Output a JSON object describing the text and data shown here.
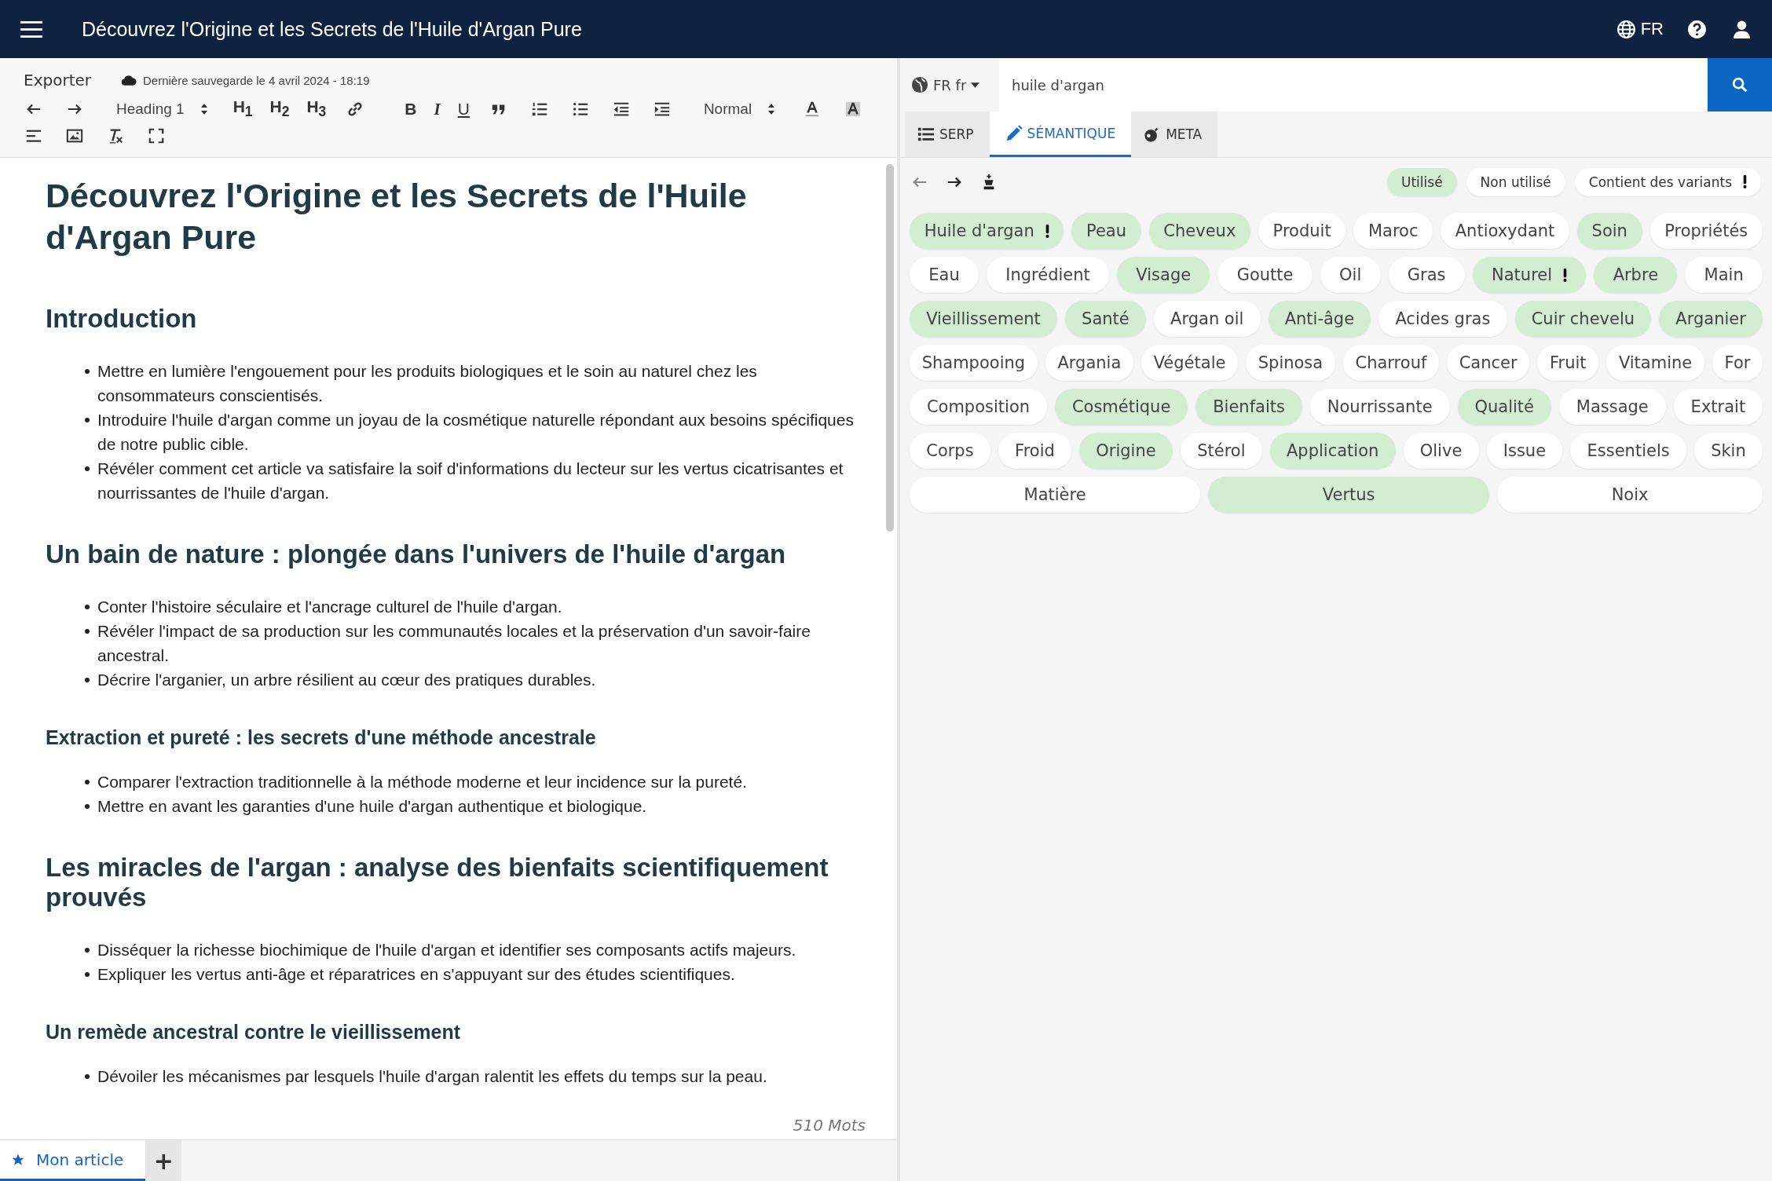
{
  "header": {
    "title": "Découvrez l'Origine et les Secrets de l'Huile d'Argan Pure",
    "lang": "FR"
  },
  "editor": {
    "export": "Exporter",
    "saved": "Dernière sauvegarde le 4 avril 2024 - 18:19",
    "toolbar": [
      [
        {
          "kind": "undo"
        },
        {
          "kind": "redo"
        },
        {
          "kind": "select",
          "label": "Heading 1"
        },
        {
          "kind": "text",
          "label": "H$_{1}$"
        },
        {
          "kind": "text",
          "label": "H$_{2}$"
        },
        {
          "kind": "text",
          "label": "H$_{3}$"
        },
        {
          "kind": "link"
        },
        {
          "kind": "text",
          "label": "B"
        },
        {
          "kind": "text",
          "label": "I"
        },
        {
          "kind": "text",
          "label": "U"
        },
        {
          "kind": "quote"
        },
        {
          "kind": "ol"
        },
        {
          "kind": "ul"
        },
        {
          "kind": "outdent"
        },
        {
          "kind": "indent"
        },
        {
          "kind": "select",
          "label": "Normal"
        },
        {
          "kind": "color"
        },
        {
          "kind": "bg"
        }
      ],
      [
        {
          "kind": "align"
        },
        {
          "kind": "image"
        },
        {
          "kind": "clear"
        },
        {
          "kind": "fullscreen"
        }
      ]
    ],
    "blocks": [
      {
        "kind": "h1",
        "text": "Découvrez l'Origine et les Secrets de l'Huile d'Argan Pure"
      },
      {
        "kind": "h2",
        "text": "Introduction"
      },
      {
        "kind": "list",
        "items": [
          "Mettre en lumière l'engouement pour les produits biologiques et le soin au naturel chez les consommateurs conscientisés.",
          "Introduire l'huile d'argan comme un joyau de la cosmétique naturelle répondant aux besoins spécifiques de notre public cible.",
          "Révéler comment cet article va satisfaire la soif d'informations du lecteur sur les vertus cicatrisantes et nourrissantes de l'huile d'argan."
        ]
      },
      {
        "kind": "h2",
        "text": "Un bain de nature : plongée dans l'univers de l'huile d'argan"
      },
      {
        "kind": "list",
        "items": [
          "Conter l'histoire séculaire et l'ancrage culturel de l'huile d'argan.",
          "Révéler l'impact de sa production sur les communautés locales et la préservation d'un savoir-faire ancestral.",
          "Décrire l'arganier, un arbre résilient au cœur des pratiques durables."
        ]
      },
      {
        "kind": "h3",
        "text": "Extraction et pureté : les secrets d'une méthode ancestrale"
      },
      {
        "kind": "list",
        "items": [
          "Comparer l'extraction traditionnelle à la méthode moderne et leur incidence sur la pureté.",
          "Mettre en avant les garanties d'une huile d'argan authentique et biologique."
        ]
      },
      {
        "kind": "h2",
        "text": "Les miracles de l'argan : analyse des bienfaits scientifiquement prouvés"
      },
      {
        "kind": "list",
        "items": [
          "Disséquer la richesse biochimique de l'huile d'argan et identifier ses composants actifs majeurs.",
          "Expliquer les vertus anti-âge et réparatrices en s'appuyant sur des études scientifiques."
        ]
      },
      {
        "kind": "h3",
        "text": "Un remède ancestral contre le vieillissement"
      },
      {
        "kind": "list",
        "items": [
          "Dévoiler les mécanismes par lesquels l'huile d'argan ralentit les effets du temps sur la peau."
        ]
      }
    ],
    "word_count": "510 Mots",
    "tabs": [
      {
        "label": "Mon article",
        "selected": true
      }
    ],
    "add_tab": "+"
  },
  "search": {
    "locale": "FR fr",
    "value": "huile d'argan"
  },
  "panel_tabs": [
    {
      "label": "SERP",
      "selected": false
    },
    {
      "label": "SÉMANTIQUE",
      "selected": true
    },
    {
      "label": "META",
      "selected": false
    }
  ],
  "filters": [
    {
      "label": "Utilisé",
      "selected": true,
      "warning": false
    },
    {
      "label": "Non utilisé",
      "selected": false,
      "warning": false
    },
    {
      "label": "Contient des variants",
      "selected": false,
      "warning": true
    }
  ],
  "tag_rows": [
    [
      {
        "label": "Huile d'argan",
        "used": true,
        "warning": true
      },
      {
        "label": "Peau",
        "used": true,
        "warning": false
      },
      {
        "label": "Cheveux",
        "used": true,
        "warning": false
      },
      {
        "label": "Produit",
        "used": false,
        "warning": false
      },
      {
        "label": "Maroc",
        "used": false,
        "warning": false
      },
      {
        "label": "Antioxydant",
        "used": false,
        "warning": false
      },
      {
        "label": "Soin",
        "used": true,
        "warning": false
      },
      {
        "label": "Propriétés",
        "used": false,
        "warning": false
      }
    ],
    [
      {
        "label": "Eau",
        "used": false,
        "warning": false
      },
      {
        "label": "Ingrédient",
        "used": false,
        "warning": false
      },
      {
        "label": "Visage",
        "used": true,
        "warning": false
      },
      {
        "label": "Goutte",
        "used": false,
        "warning": false
      },
      {
        "label": "Oil",
        "used": false,
        "warning": false
      },
      {
        "label": "Gras",
        "used": false,
        "warning": false
      },
      {
        "label": "Naturel",
        "used": true,
        "warning": true
      },
      {
        "label": "Arbre",
        "used": true,
        "warning": false
      },
      {
        "label": "Main",
        "used": false,
        "warning": false
      }
    ],
    [
      {
        "label": "Vieillissement",
        "used": true,
        "warning": false
      },
      {
        "label": "Santé",
        "used": true,
        "warning": false
      },
      {
        "label": "Argan oil",
        "used": false,
        "warning": false
      },
      {
        "label": "Anti-âge",
        "used": true,
        "warning": false
      },
      {
        "label": "Acides gras",
        "used": false,
        "warning": false
      },
      {
        "label": "Cuir chevelu",
        "used": true,
        "warning": false
      },
      {
        "label": "Arganier",
        "used": true,
        "warning": false
      }
    ],
    [
      {
        "label": "Shampooing",
        "used": false,
        "warning": false
      },
      {
        "label": "Argania",
        "used": false,
        "warning": false
      },
      {
        "label": "Végétale",
        "used": false,
        "warning": false
      },
      {
        "label": "Spinosa",
        "used": false,
        "warning": false
      },
      {
        "label": "Charrouf",
        "used": false,
        "warning": false
      },
      {
        "label": "Cancer",
        "used": false,
        "warning": false
      },
      {
        "label": "Fruit",
        "used": false,
        "warning": false
      },
      {
        "label": "Vitamine",
        "used": false,
        "warning": false
      },
      {
        "label": "For",
        "used": false,
        "warning": false
      }
    ],
    [
      {
        "label": "Composition",
        "used": false,
        "warning": false
      },
      {
        "label": "Cosmétique",
        "used": true,
        "warning": false
      },
      {
        "label": "Bienfaits",
        "used": true,
        "warning": false
      },
      {
        "label": "Nourrissante",
        "used": false,
        "warning": false
      },
      {
        "label": "Qualité",
        "used": true,
        "warning": false
      },
      {
        "label": "Massage",
        "used": false,
        "warning": false
      },
      {
        "label": "Extrait",
        "used": false,
        "warning": false
      }
    ],
    [
      {
        "label": "Corps",
        "used": false,
        "warning": false
      },
      {
        "label": "Froid",
        "used": false,
        "warning": false
      },
      {
        "label": "Origine",
        "used": true,
        "warning": false
      },
      {
        "label": "Stérol",
        "used": false,
        "warning": false
      },
      {
        "label": "Application",
        "used": true,
        "warning": false
      },
      {
        "label": "Olive",
        "used": false,
        "warning": false
      },
      {
        "label": "Issue",
        "used": false,
        "warning": false
      },
      {
        "label": "Essentiels",
        "used": false,
        "warning": false
      },
      {
        "label": "Skin",
        "used": false,
        "warning": false
      }
    ],
    [
      {
        "label": "Matière",
        "used": false,
        "warning": false
      },
      {
        "label": "Vertus",
        "used": true,
        "warning": false
      },
      {
        "label": "Noix",
        "used": false,
        "warning": false
      }
    ]
  ]
}
